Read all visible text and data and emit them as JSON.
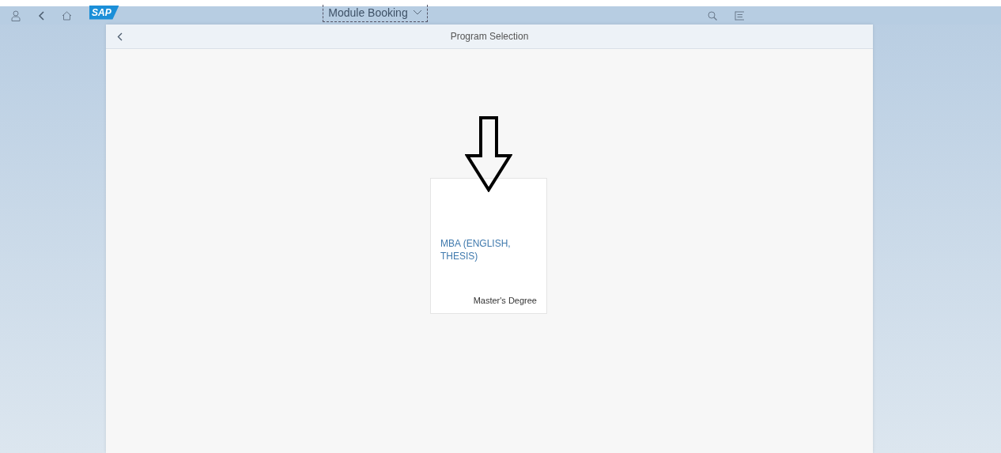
{
  "shell_bar": {
    "logo": "SAP",
    "title": "Module Booking"
  },
  "page": {
    "title": "Program Selection"
  },
  "tiles": [
    {
      "title": "MBA (ENGLISH, THESIS)",
      "subtitle": "Master's Degree"
    }
  ]
}
